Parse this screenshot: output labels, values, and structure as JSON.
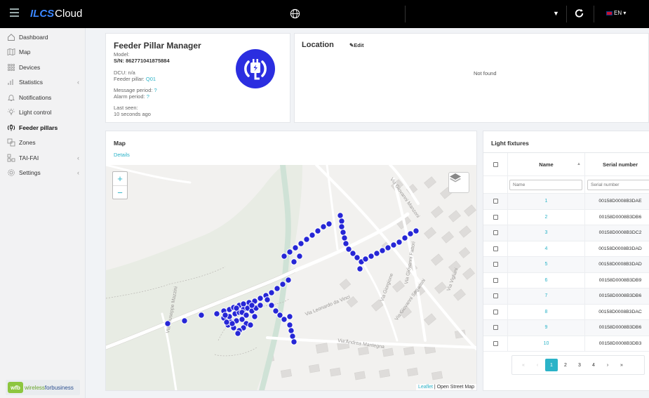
{
  "topbar": {
    "logo_brand": "ILCS",
    "logo_product": "Cloud",
    "language": "EN"
  },
  "sidebar": {
    "items": [
      {
        "label": "Dashboard",
        "icon": "home-icon"
      },
      {
        "label": "Map",
        "icon": "map-icon"
      },
      {
        "label": "Devices",
        "icon": "devices-icon"
      },
      {
        "label": "Statistics",
        "icon": "bar-chart-icon"
      },
      {
        "label": "Notifications",
        "icon": "bell-icon"
      },
      {
        "label": "Light control",
        "icon": "bulb-icon"
      },
      {
        "label": "Feeder pillars",
        "icon": "plug-icon"
      },
      {
        "label": "Zones",
        "icon": "zones-icon"
      },
      {
        "label": "TAI-FAI",
        "icon": "network-icon"
      },
      {
        "label": "Settings",
        "icon": "gear-icon"
      }
    ],
    "footer_logo_a": "wireless",
    "footer_logo_b": "forbusiness"
  },
  "feeder": {
    "title": "Feeder Pillar Manager",
    "model_label": "Model:",
    "serial_label": "S/N: 862771041875884",
    "dcu": "DCU: n/a",
    "feeder_pillar_label": "Feeder pillar: ",
    "feeder_pillar_value": "Q01",
    "message_period_label": "Message period: ",
    "message_period_value": "?",
    "alarm_period_label": "Alarm period: ",
    "alarm_period_value": "?",
    "last_seen_label": "Last seen:",
    "last_seen_value": "10 seconds ago"
  },
  "location": {
    "title": "Location",
    "edit_label": "Edit",
    "status": "Not found"
  },
  "map": {
    "title": "Map",
    "details_link": "Details",
    "attribution_leaflet": "Leaflet",
    "attribution_osm": " | Open Street Map",
    "street_labels": [
      "Via Leonardo da Vinci",
      "Via Andrea Mantegna",
      "Via Giovanni Segantini",
      "Via Giovanni Fattori",
      "Via Giorgione",
      "Via Giuseppe Mazzini",
      "Via Vigliani",
      "Via Giovanni Manzoni"
    ]
  },
  "fixtures": {
    "title": "Light fixtures",
    "col_name": "Name",
    "col_serial": "Serial number",
    "filter_name_placeholder": "Name",
    "filter_serial_placeholder": "Serial number",
    "rows": [
      {
        "name": "1",
        "serial": "00158D0008B3DAE"
      },
      {
        "name": "2",
        "serial": "00158D0008B3DB6"
      },
      {
        "name": "3",
        "serial": "00158D0008B3DC2"
      },
      {
        "name": "4",
        "serial": "00158D0008B3DAD"
      },
      {
        "name": "5",
        "serial": "00158D0008B3DAD"
      },
      {
        "name": "6",
        "serial": "00158D0008B3DB9"
      },
      {
        "name": "7",
        "serial": "00158D0008B3DB6"
      },
      {
        "name": "8",
        "serial": "00158D0008B3DAC"
      },
      {
        "name": "9",
        "serial": "00158D0008B3DB6"
      },
      {
        "name": "10",
        "serial": "00158D0008B3DB3"
      }
    ],
    "pager": {
      "first": "«",
      "prev": "‹",
      "pages": [
        "1",
        "2",
        "3",
        "4"
      ],
      "next": "›",
      "last": "»"
    }
  }
}
